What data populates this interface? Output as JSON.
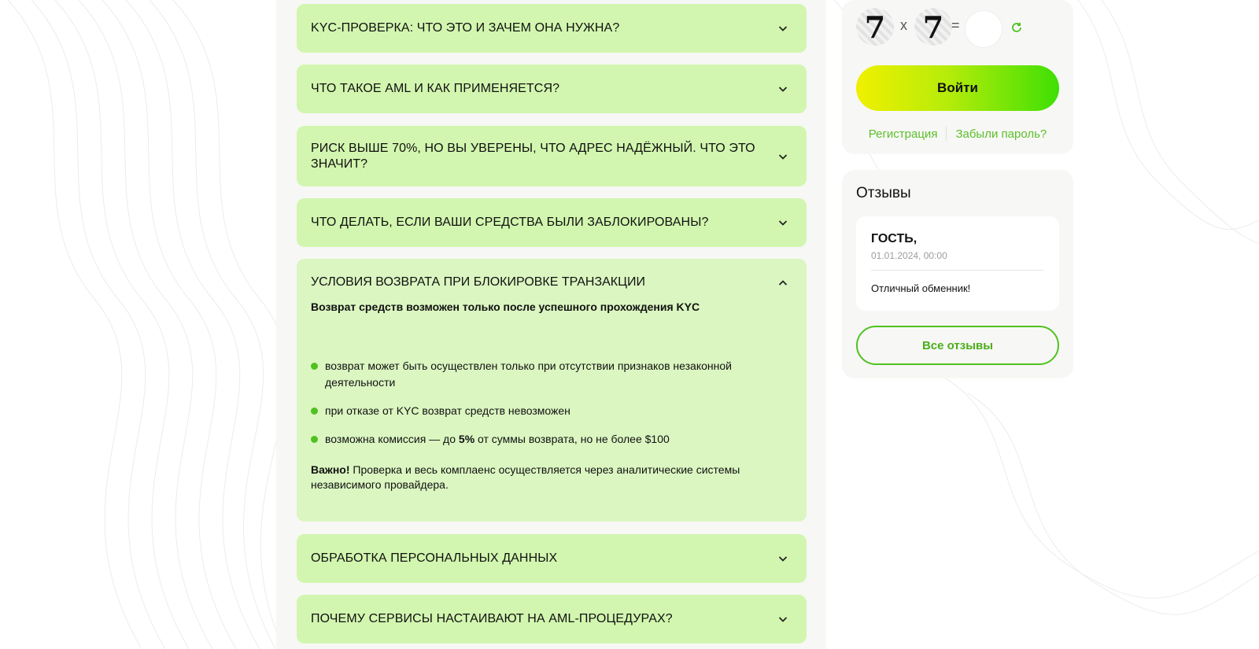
{
  "colors": {
    "faq_bg": "#d2f6af",
    "faq_open_bg": "#dbf6c1",
    "accent_green": "#4fc21f",
    "link_green": "#5cbf2a",
    "panel_bg": "#f7f7f5"
  },
  "faq": {
    "items": [
      {
        "question": "KYC-ПРОВЕРКА: ЧТО ЭТО И ЗАЧЕМ ОНА НУЖНА?",
        "icon": "chevron-down-icon"
      },
      {
        "question": "ЧТО ТАКОЕ AML И КАК ПРИМЕНЯЕТСЯ?",
        "icon": "chevron-down-icon"
      },
      {
        "question": "РИСК ВЫШЕ 70%, НО ВЫ УВЕРЕНЫ, ЧТО АДРЕС НАДЁЖНЫЙ. ЧТО ЭТО ЗНАЧИТ?",
        "icon": "chevron-down-icon"
      },
      {
        "question": "ЧТО ДЕЛАТЬ, ЕСЛИ ВАШИ СРЕДСТВА БЫЛИ ЗАБЛОКИРОВАНЫ?",
        "icon": "chevron-down-icon"
      }
    ],
    "open_item": {
      "question": "УСЛОВИЯ ВОЗВРАТА ПРИ БЛОКИРОВКЕ ТРАНЗАКЦИИ",
      "icon": "chevron-up-icon",
      "lead": "Возврат средств возможен только после успешного прохождения KYC",
      "bullets": [
        "возврат может быть осуществлен только при отсутствии признаков незаконной деятельности",
        "при отказе от KYC возврат средств невозможен"
      ],
      "bullet3_prefix": "возможна комиссия — до ",
      "bullet3_bold": "5%",
      "bullet3_suffix": " от суммы возврата, но не более $100",
      "note_bold": "Важно!",
      "note_text": " Проверка и весь комплаенс осуществляется через аналитические системы независимого провайдера."
    },
    "items_after": [
      {
        "question": "ОБРАБОТКА ПЕРСОНАЛЬНЫХ ДАННЫХ",
        "icon": "chevron-down-icon"
      },
      {
        "question": "ПОЧЕМУ СЕРВИСЫ НАСТАИВАЮТ НА AML-ПРОЦЕДУРАХ?",
        "icon": "chevron-down-icon"
      }
    ]
  },
  "login": {
    "captcha": {
      "a": "7",
      "op": "x",
      "b": "7",
      "eq": "=",
      "refresh_icon": "refresh-icon"
    },
    "submit_label": "Войти",
    "register_link": "Регистрация",
    "forgot_link": "Забыли пароль?"
  },
  "reviews": {
    "title": "Отзывы",
    "items": [
      {
        "author": "ГОСТЬ,",
        "date": "01.01.2024, 00:00",
        "text": "Отличный обменник!"
      }
    ],
    "all_label": "Все отзывы"
  }
}
